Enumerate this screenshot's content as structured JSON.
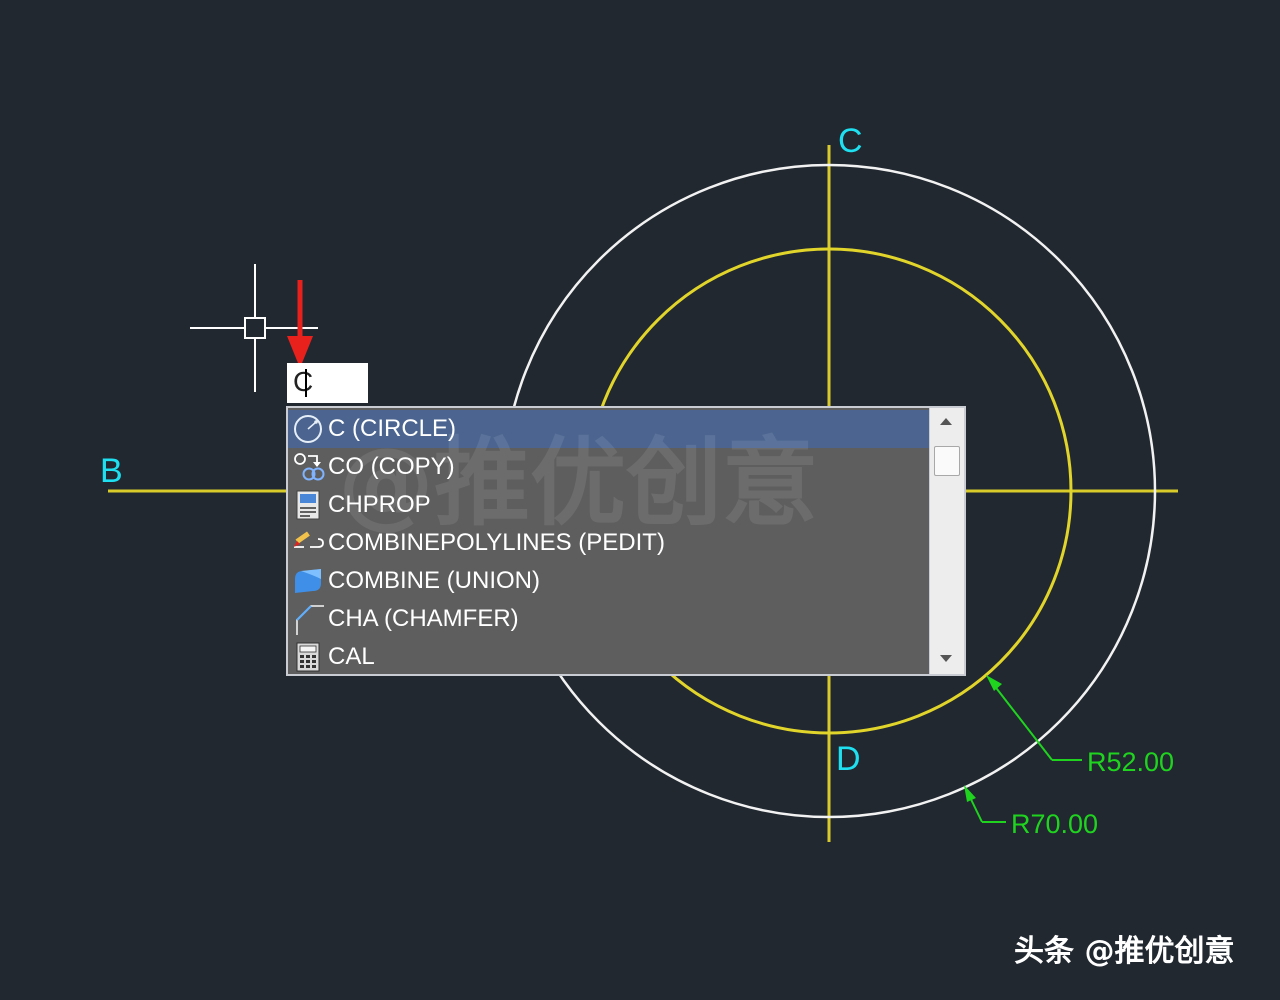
{
  "colors": {
    "background": "#212830",
    "outer_circle": "#f2f2f2",
    "inner_circle": "#e1d42a",
    "axis_line": "#d8cb2a",
    "quadrant_label": "#1ee0f0",
    "dimension": "#1fd31f",
    "annotation_arrow": "#e8211c",
    "list_selected": "#4b6590",
    "list_background": "#5e5e5e"
  },
  "drawing": {
    "labels": {
      "b": "B",
      "c": "C",
      "d": "D"
    },
    "dimensions": [
      {
        "text": "R52.00"
      },
      {
        "text": "R70.00"
      }
    ]
  },
  "command_input": {
    "value": "C"
  },
  "autocomplete": {
    "items": [
      {
        "label": "C (CIRCLE)",
        "icon": "circle-icon",
        "selected": true
      },
      {
        "label": "CO (COPY)",
        "icon": "copy-icon",
        "selected": false
      },
      {
        "label": "CHPROP",
        "icon": "properties-icon",
        "selected": false
      },
      {
        "label": "COMBINEPOLYLINES (PEDIT)",
        "icon": "polyline-edit-icon",
        "selected": false
      },
      {
        "label": "COMBINE (UNION)",
        "icon": "union-icon",
        "selected": false
      },
      {
        "label": "CHA (CHAMFER)",
        "icon": "chamfer-icon",
        "selected": false
      },
      {
        "label": "CAL",
        "icon": "calculator-icon",
        "selected": false
      }
    ]
  },
  "watermark": "@推优创意",
  "credit": "头条 @推优创意"
}
